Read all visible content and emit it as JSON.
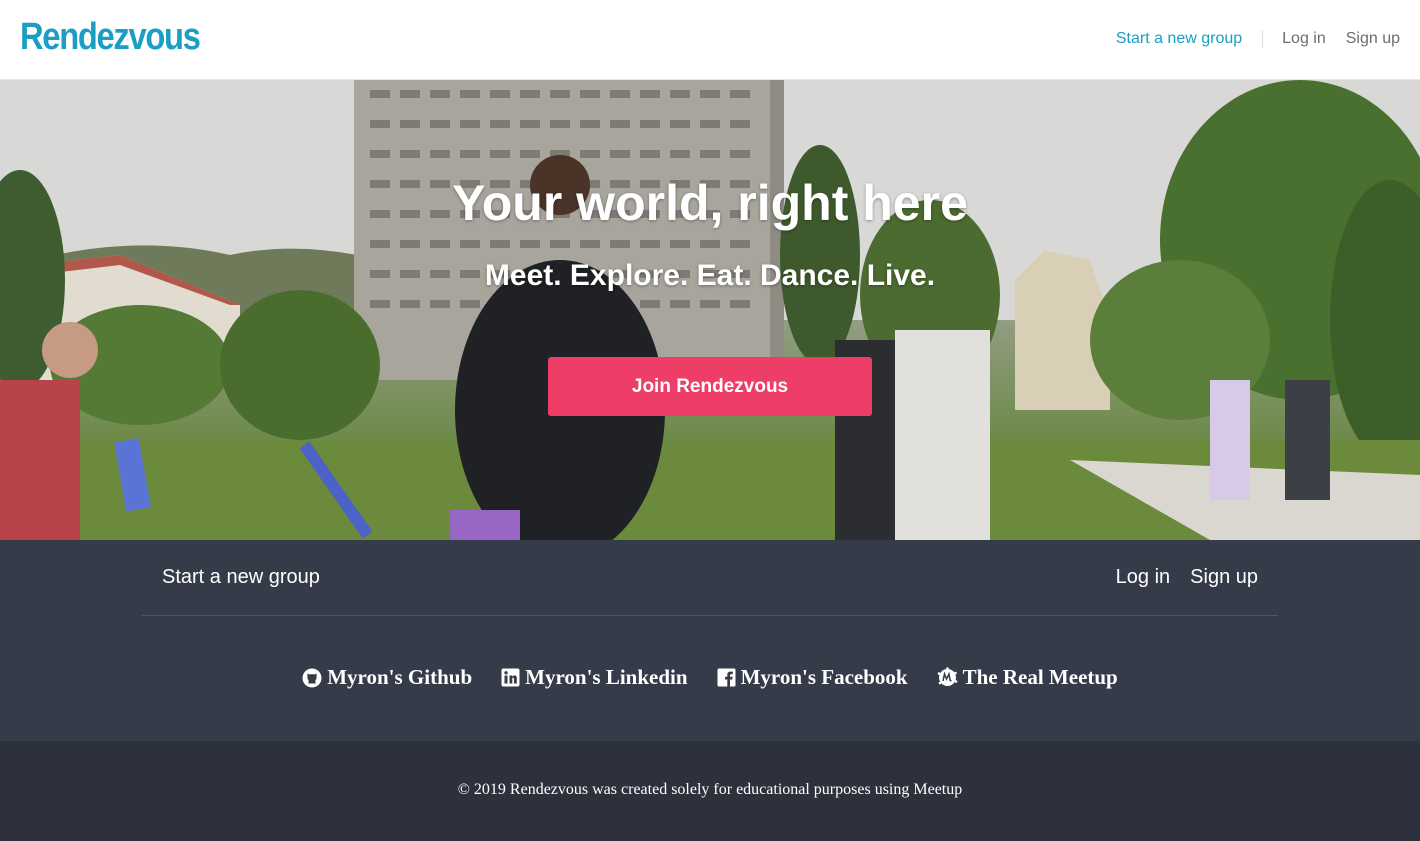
{
  "header": {
    "logo": "Rendezvous",
    "nav": {
      "start_group": "Start a new group",
      "login": "Log in",
      "signup": "Sign up"
    }
  },
  "hero": {
    "title": "Your world, right here",
    "subtitle": "Meet. Explore. Eat. Dance. Live.",
    "cta": "Join Rendezvous"
  },
  "footer": {
    "nav": {
      "start_group": "Start a new group",
      "login": "Log in",
      "signup": "Sign up"
    },
    "links": [
      {
        "label": "Myron's Github",
        "icon": "github-icon"
      },
      {
        "label": "Myron's Linkedin",
        "icon": "linkedin-icon"
      },
      {
        "label": "Myron's Facebook",
        "icon": "facebook-icon"
      },
      {
        "label": "The Real Meetup",
        "icon": "meetup-icon"
      }
    ],
    "copyright": "© 2019 Rendezvous was created solely for educational purposes using Meetup"
  },
  "colors": {
    "brand": "#1b9ec4",
    "cta": "#ee3e67",
    "footer_upper": "#353b48",
    "footer_lower": "#2c313c"
  }
}
